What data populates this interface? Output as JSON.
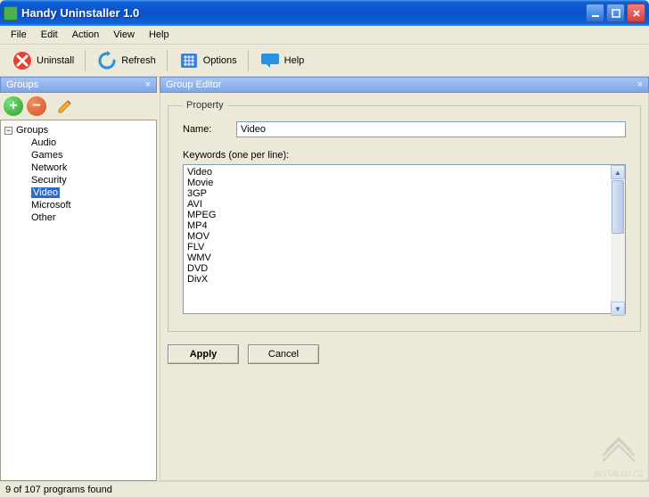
{
  "window": {
    "title": "Handy Uninstaller 1.0"
  },
  "menubar": [
    "File",
    "Edit",
    "Action",
    "View",
    "Help"
  ],
  "toolbar": {
    "uninstall": "Uninstall",
    "refresh": "Refresh",
    "options": "Options",
    "help": "Help"
  },
  "sidebar": {
    "header": "Groups",
    "root": "Groups",
    "items": [
      "Audio",
      "Games",
      "Network",
      "Security",
      "Video",
      "Microsoft",
      "Other"
    ],
    "selected_index": 4
  },
  "editor": {
    "header": "Group Editor",
    "legend": "Property",
    "name_label": "Name:",
    "name_value": "Video",
    "keywords_label": "Keywords (one per line):",
    "keywords": "Video\nMovie\n3GP\nAVI\nMPEG\nMP4\nMOV\nFLV\nWMV\nDVD\nDivX",
    "apply": "Apply",
    "cancel": "Cancel"
  },
  "statusbar": "9 of 107 programs found",
  "watermark": "INSTALUJ.CZ"
}
